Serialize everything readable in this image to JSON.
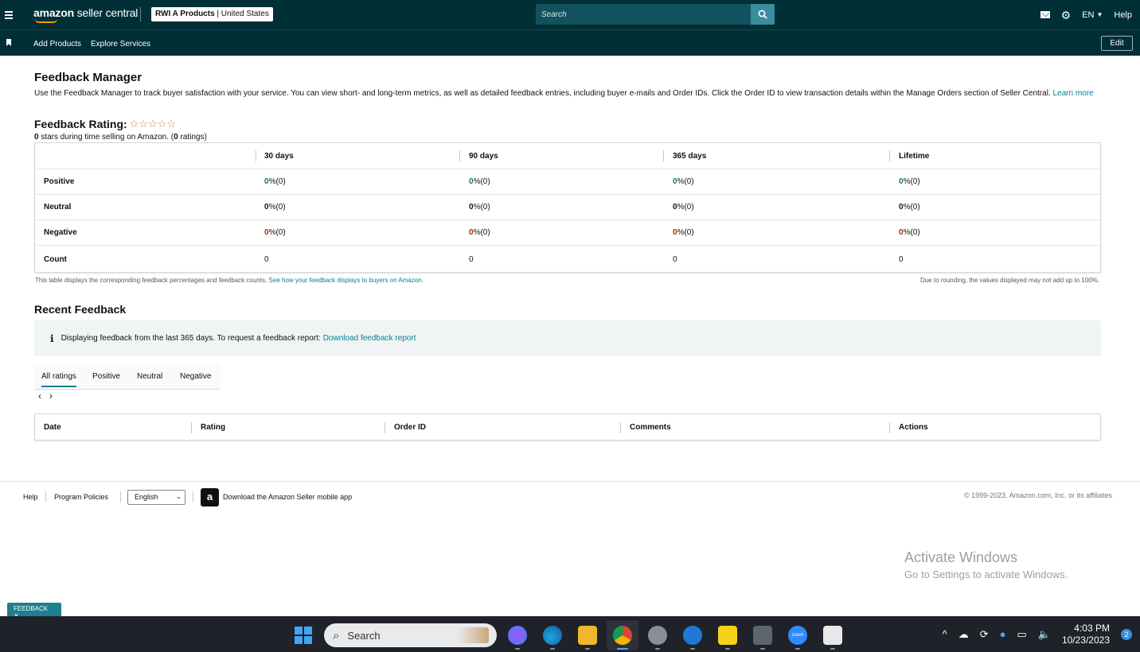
{
  "topbar": {
    "brand_strong": "amazon",
    "brand_rest": " seller central",
    "store_name": "RWI A Products",
    "store_region": " | United States",
    "search_placeholder": "Search",
    "lang": "EN",
    "help": "Help"
  },
  "subnav": {
    "items": [
      "Add Products",
      "Explore Services"
    ],
    "edit": "Edit"
  },
  "page": {
    "title": "Feedback Manager",
    "intro": "Use the Feedback Manager to track buyer satisfaction with your service. You can view short- and long-term metrics, as well as detailed feedback entries, including buyer e-mails and Order IDs. Click the Order ID to view transaction details within the Manage Orders section of Seller Central.",
    "learn_more": "Learn more",
    "rating_title": "Feedback Rating:",
    "stars": "☆☆☆☆☆",
    "stars_count": "0",
    "stars_text": " stars during time selling on Amazon. (",
    "ratings_count": "0",
    "ratings_text": " ratings)"
  },
  "feedback_table": {
    "headers": [
      "30 days",
      "90 days",
      "365 days",
      "Lifetime"
    ],
    "rows": [
      {
        "label": "Positive",
        "cells": [
          "0",
          "0",
          "0",
          "0"
        ],
        "suffix": " %(0)"
      },
      {
        "label": "Neutral",
        "cells": [
          "0",
          "0",
          "0",
          "0"
        ],
        "suffix": " %(0)"
      },
      {
        "label": "Negative",
        "cells": [
          "0",
          "0",
          "0",
          "0"
        ],
        "suffix": " %(0)"
      },
      {
        "label": "Count",
        "cells": [
          "0",
          "0",
          "0",
          "0"
        ],
        "suffix": ""
      }
    ],
    "note_left": "This table displays the corresponding feedback percentages and feedback counts.",
    "note_left_link": "See how your feedback displays to buyers on Amazon.",
    "note_right": "Due to rounding, the values displayed may not add up to 100%."
  },
  "recent": {
    "title": "Recent Feedback",
    "info_icon": "i",
    "info_text": "Displaying feedback from the last 365 days. To request a feedback report: ",
    "info_link": "Download feedback report",
    "tabs": [
      "All ratings",
      "Positive",
      "Neutral",
      "Negative"
    ],
    "prev": "‹",
    "next": "›",
    "columns": [
      "Date",
      "Rating",
      "Order ID",
      "Comments",
      "Actions"
    ]
  },
  "footer": {
    "help": "Help",
    "policies": "Program Policies",
    "language": "English",
    "caret": "⌄",
    "app_badge": "a",
    "app_text": "Download the Amazon Seller mobile app",
    "copyright": "© 1999-2023, Amazon.com, Inc. or its affiliates"
  },
  "watermark": {
    "line1": "Activate Windows",
    "line2": "Go to Settings to activate Windows."
  },
  "feedback_pill": {
    "label": "FEEDBACK",
    "close": "✕"
  },
  "taskbar": {
    "search": "Search",
    "time": "4:03 PM",
    "date": "10/23/2023",
    "notifications": "2",
    "apps": [
      "messenger-icon",
      "edge-icon",
      "file-explorer-icon",
      "chrome-icon",
      "settings-icon",
      "get-help-icon",
      "sticky-notes-icon",
      "calculator-icon",
      "zoom-icon",
      "snipping-tool-icon"
    ],
    "zoom_label": "zoom"
  }
}
